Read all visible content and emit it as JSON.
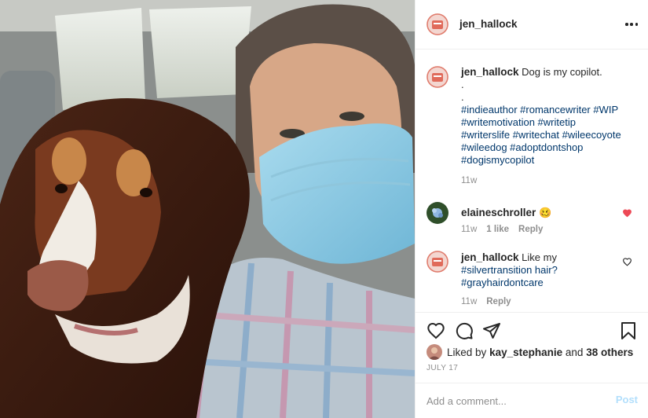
{
  "post": {
    "username": "jen_hallock",
    "photo_alt": "Selfie with dog in car",
    "caption": {
      "text": "Dog is my copilot.",
      "dots": [
        ".",
        "."
      ],
      "hashtags_lines": [
        "#indieauthor #romancewriter #WIP",
        "#writemotivation #writetip",
        "#writerslife #writechat #wileecoyote",
        "#wileedog #adoptdontshop",
        "#dogismycopilot"
      ],
      "time": "11w"
    },
    "comments": [
      {
        "username": "elaineschroller",
        "emoji": "🥴",
        "time": "11w",
        "likes": "1 like",
        "reply": "Reply",
        "liked": true
      },
      {
        "username": "jen_hallock",
        "text": "Like my",
        "text_lines": [
          "#silvertransition hair?",
          "#grayhairdontcare"
        ],
        "time": "11w",
        "reply": "Reply",
        "liked": false
      }
    ],
    "likes": {
      "prefix": "Liked by",
      "user": "kay_stephanie",
      "and": "and",
      "others": "38 others"
    },
    "date": "JULY 17",
    "comment_input": {
      "placeholder": "Add a comment..."
    },
    "post_button": "Post",
    "colors": {
      "like_red": "#ed4956",
      "hashtag_blue": "#00376b",
      "post_blue_disabled": "#b2dffc"
    },
    "icons": [
      "more-icon",
      "heart-icon",
      "comment-icon",
      "share-icon",
      "bookmark-icon"
    ]
  }
}
